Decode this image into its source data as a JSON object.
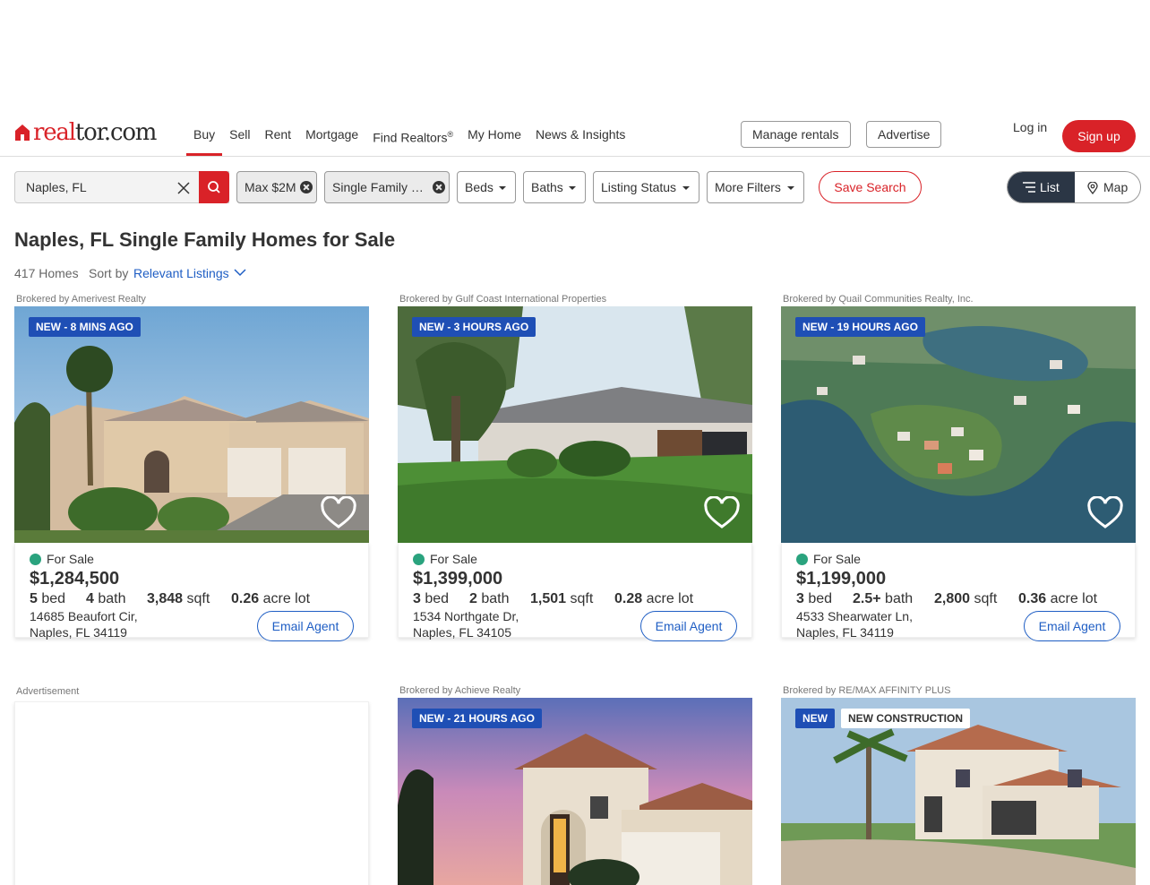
{
  "header": {
    "logo_text_a": "real",
    "logo_text_b": "tor.com",
    "nav": [
      {
        "label": "Buy"
      },
      {
        "label": "Sell"
      },
      {
        "label": "Rent"
      },
      {
        "label": "Mortgage"
      },
      {
        "label": "Find Realtors",
        "sup": "®"
      },
      {
        "label": "My Home"
      },
      {
        "label": "News & Insights"
      }
    ],
    "manage_rentals": "Manage rentals",
    "advertise": "Advertise",
    "login": "Log in",
    "signup": "Sign up"
  },
  "search": {
    "value": "Naples, FL",
    "price_chip": "Max $2M",
    "type_chip": "Single Family …",
    "beds": "Beds",
    "baths": "Baths",
    "listing_status": "Listing Status",
    "more_filters": "More Filters",
    "save_search": "Save Search",
    "view_list": "List",
    "view_map": "Map"
  },
  "results": {
    "title": "Naples, FL Single Family Homes for Sale",
    "count": "417 Homes",
    "sort_label": "Sort by",
    "sort_value": "Relevant Listings"
  },
  "listings": [
    {
      "broker": "Brokered by Amerivest Realty",
      "badge": "NEW - 8 MINS AGO",
      "status": "For Sale",
      "price": "$1,284,500",
      "beds": "5",
      "beds_unit": "bed",
      "baths": "4",
      "baths_unit": "bath",
      "sqft": "3,848",
      "sqft_unit": "sqft",
      "lot": "0.26",
      "lot_unit": "acre lot",
      "address1": "14685 Beaufort Cir,",
      "address2": "Naples, FL 34119",
      "email": "Email Agent"
    },
    {
      "broker": "Brokered by Gulf Coast International Properties",
      "badge": "NEW - 3 HOURS AGO",
      "status": "For Sale",
      "price": "$1,399,000",
      "beds": "3",
      "beds_unit": "bed",
      "baths": "2",
      "baths_unit": "bath",
      "sqft": "1,501",
      "sqft_unit": "sqft",
      "lot": "0.28",
      "lot_unit": "acre lot",
      "address1": "1534 Northgate Dr,",
      "address2": "Naples, FL 34105",
      "email": "Email Agent"
    },
    {
      "broker": "Brokered by Quail Communities Realty, Inc.",
      "badge": "NEW - 19 HOURS AGO",
      "status": "For Sale",
      "price": "$1,199,000",
      "beds": "3",
      "beds_unit": "bed",
      "baths": "2.5+",
      "baths_unit": "bath",
      "sqft": "2,800",
      "sqft_unit": "sqft",
      "lot": "0.36",
      "lot_unit": "acre lot",
      "address1": "4533 Shearwater Ln,",
      "address2": "Naples, FL 34119",
      "email": "Email Agent"
    },
    {
      "broker": "Brokered by Achieve Realty",
      "badge": "NEW - 21 HOURS AGO"
    },
    {
      "broker": "Brokered by RE/MAX AFFINITY PLUS",
      "badge": "NEW",
      "badge2": "NEW CONSTRUCTION"
    }
  ],
  "advertisement_label": "Advertisement",
  "colors": {
    "brand_red": "#d92228",
    "link_blue": "#1f5ec4",
    "badge_blue": "#1f4fb5",
    "status_green": "#2aa37e"
  }
}
